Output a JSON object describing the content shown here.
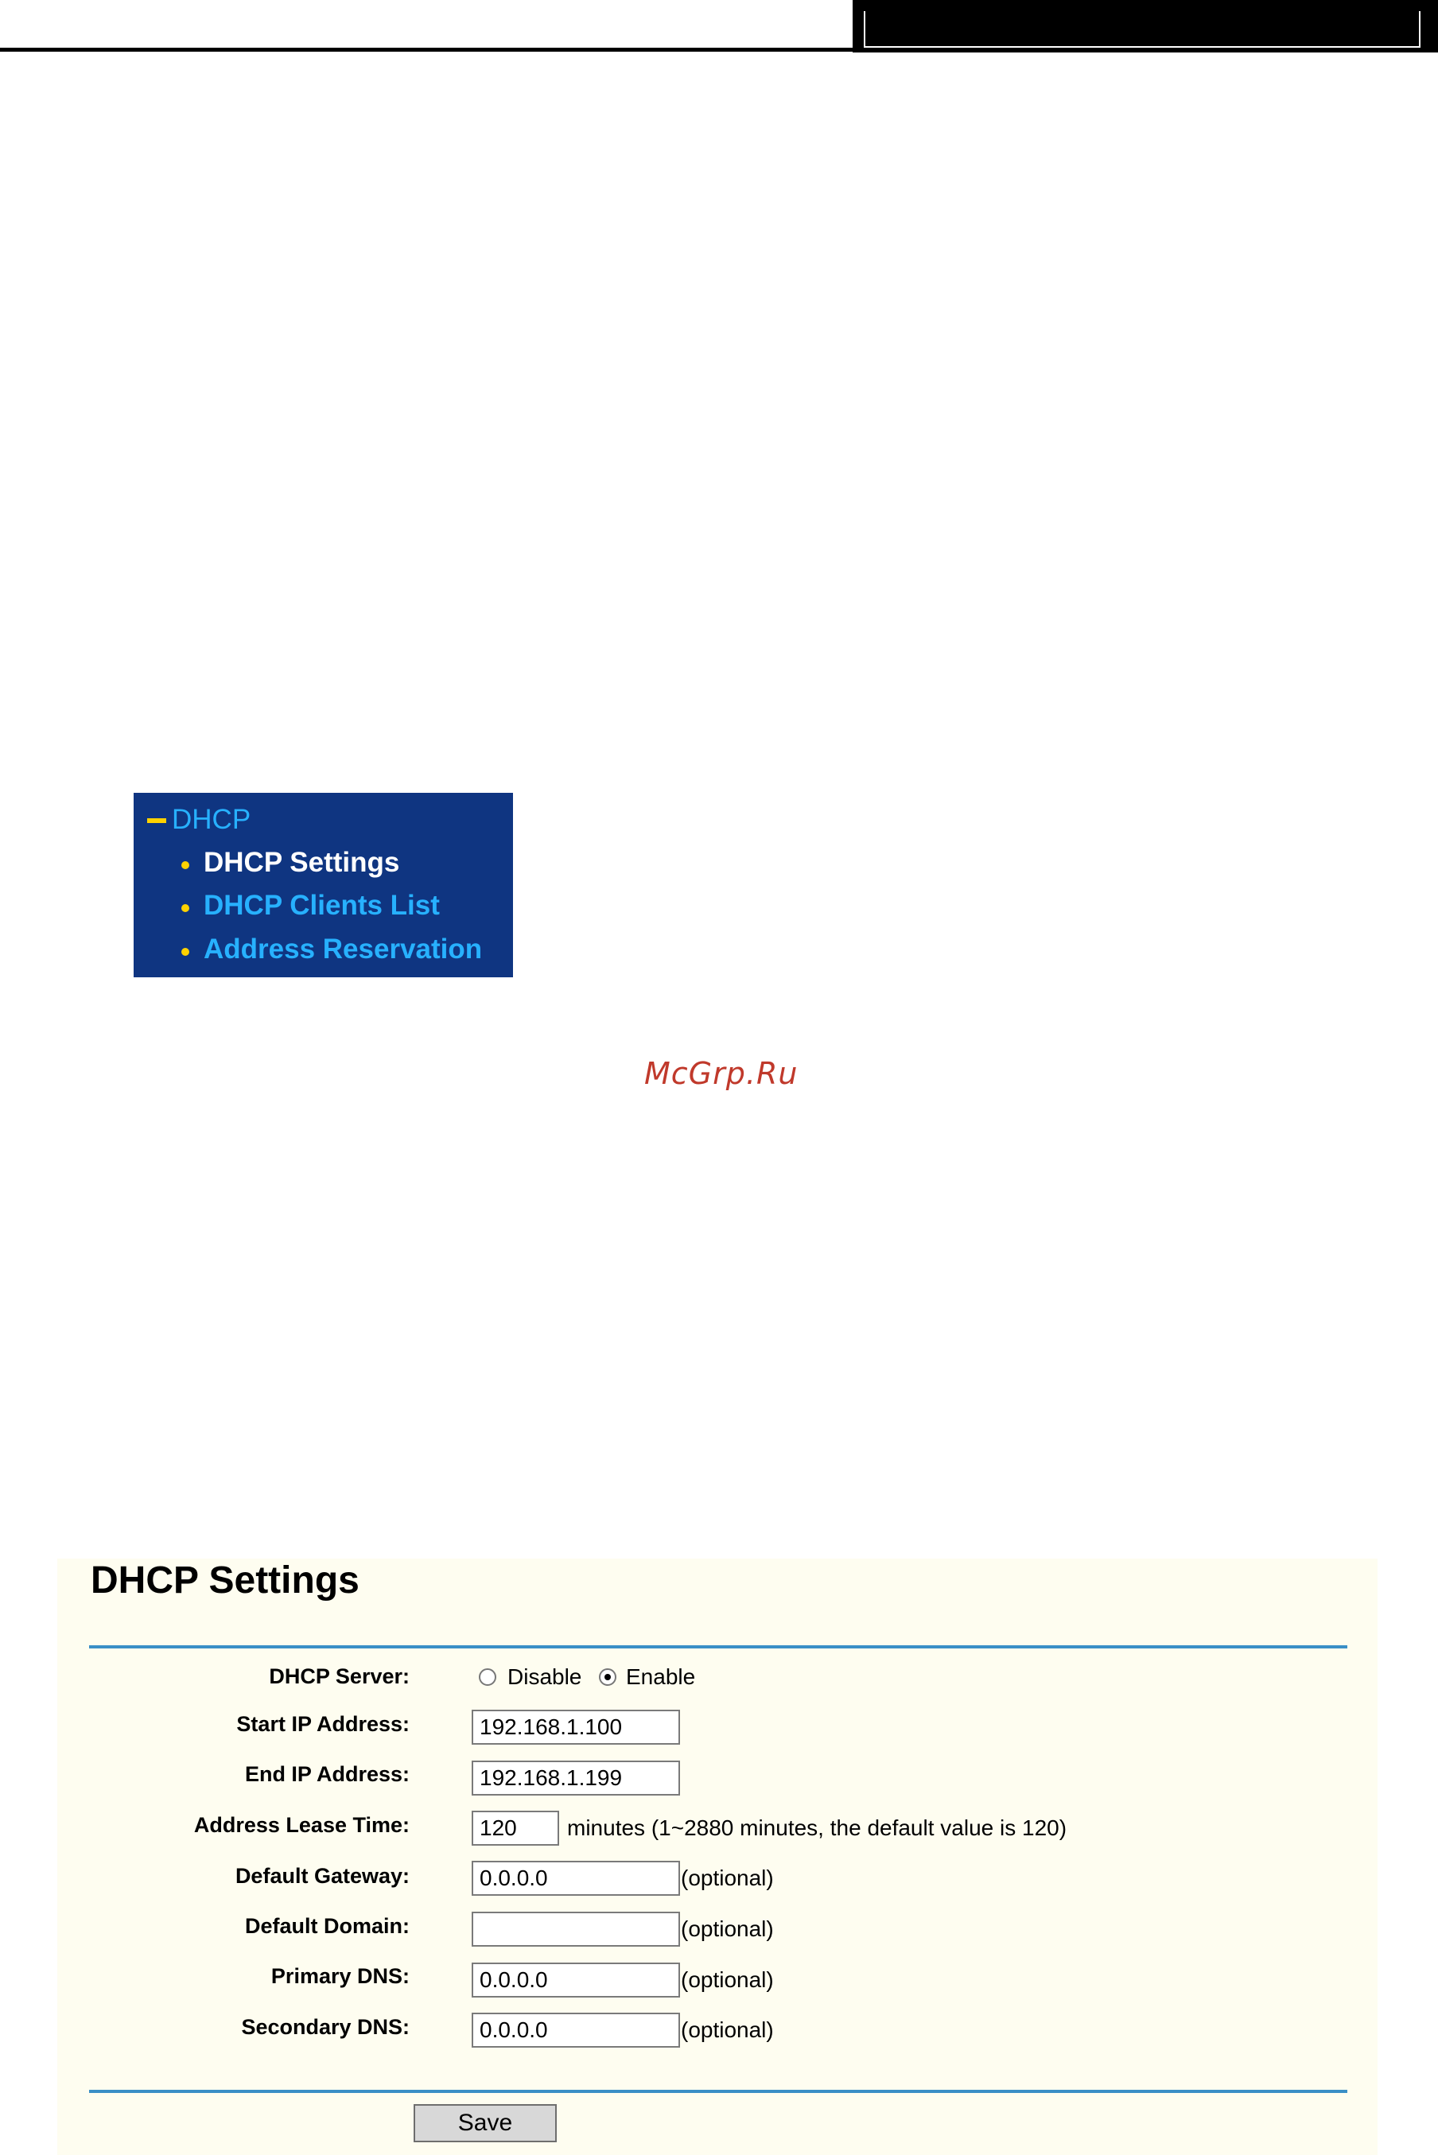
{
  "menu": {
    "heading": "DHCP",
    "items": [
      {
        "label": "DHCP Settings"
      },
      {
        "label": "DHCP Clients List"
      },
      {
        "label": "Address Reservation"
      }
    ]
  },
  "watermark": "McGrp.Ru",
  "dhcp_settings": {
    "title": "DHCP Settings",
    "server_label": "DHCP Server:",
    "disable_label": "Disable",
    "enable_label": "Enable",
    "server_state": "Enable",
    "start_ip_label": "Start IP Address:",
    "start_ip_value": "192.168.1.100",
    "end_ip_label": "End IP Address:",
    "end_ip_value": "192.168.1.199",
    "lease_label": "Address Lease Time:",
    "lease_value": "120",
    "lease_hint": "minutes (1~2880 minutes, the default value is 120)",
    "gateway_label": "Default Gateway:",
    "gateway_value": "0.0.0.0",
    "domain_label": "Default Domain:",
    "domain_value": "",
    "primary_dns_label": "Primary DNS:",
    "primary_dns_value": "0.0.0.0",
    "secondary_dns_label": "Secondary DNS:",
    "secondary_dns_value": "0.0.0.0",
    "optional_hint": "(optional)",
    "save_label": "Save"
  }
}
